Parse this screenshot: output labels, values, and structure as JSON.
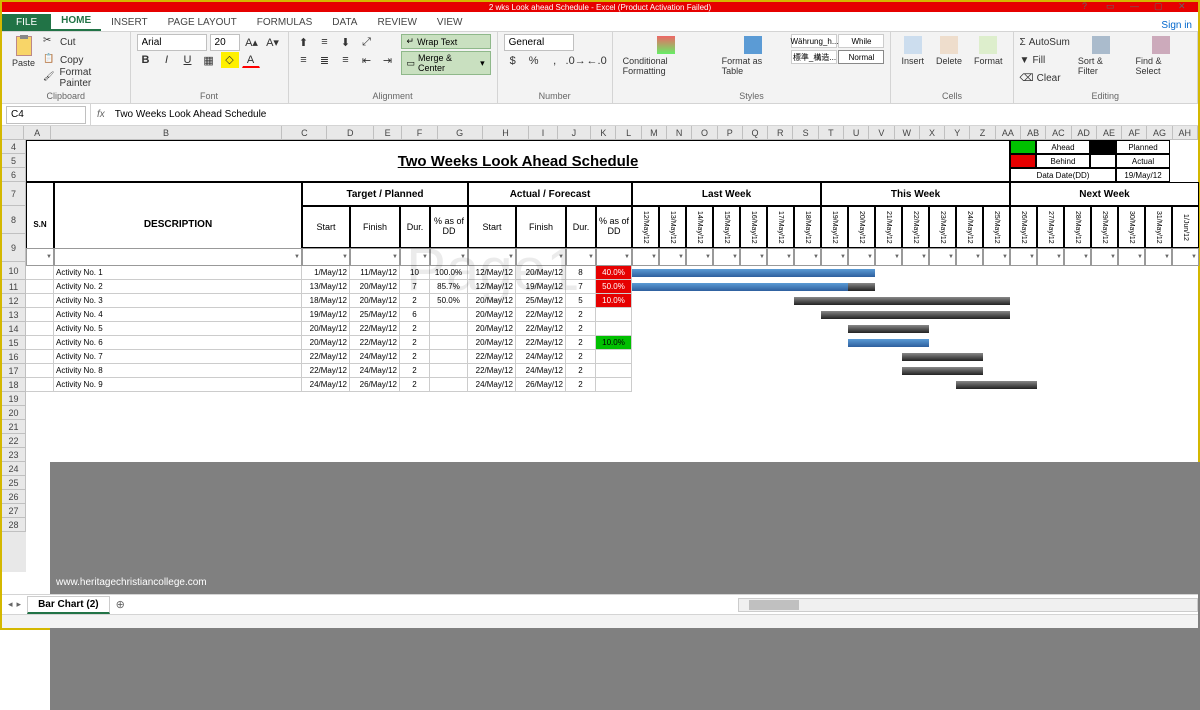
{
  "titlebar": {
    "text": "2 wks Look ahead Schedule - Excel (Product Activation Failed)"
  },
  "tabs": {
    "file": "FILE",
    "items": [
      "HOME",
      "INSERT",
      "PAGE LAYOUT",
      "FORMULAS",
      "DATA",
      "REVIEW",
      "VIEW"
    ],
    "signin": "Sign in"
  },
  "ribbon": {
    "clipboard": {
      "paste": "Paste",
      "cut": "Cut",
      "copy": "Copy",
      "fp": "Format Painter",
      "label": "Clipboard"
    },
    "font": {
      "name": "Arial",
      "size": "20",
      "label": "Font"
    },
    "alignment": {
      "wrap": "Wrap Text",
      "merge": "Merge & Center",
      "label": "Alignment"
    },
    "number": {
      "fmt": "General",
      "label": "Number"
    },
    "styles": {
      "cf": "Conditional Formatting",
      "fat": "Format as Table",
      "s1": "Währung_h...",
      "s2": "標準_構造...",
      "s3": "While",
      "s4": "Normal",
      "label": "Styles"
    },
    "cells": {
      "insert": "Insert",
      "delete": "Delete",
      "format": "Format",
      "label": "Cells"
    },
    "editing": {
      "autosum": "AutoSum",
      "fill": "Fill",
      "clear": "Clear",
      "sort": "Sort & Filter",
      "find": "Find & Select",
      "label": "Editing"
    }
  },
  "fbar": {
    "cell": "C4",
    "formula": "Two Weeks Look Ahead Schedule"
  },
  "cols": [
    "A",
    "B",
    "C",
    "D",
    "E",
    "F",
    "G",
    "H",
    "I",
    "J",
    "K",
    "L",
    "M",
    "N",
    "O",
    "P",
    "Q",
    "R",
    "S",
    "T",
    "U",
    "V",
    "W",
    "X",
    "Y",
    "Z",
    "AA",
    "AB",
    "AC",
    "AD",
    "AE",
    "AF",
    "AG",
    "AH"
  ],
  "rows": [
    "4",
    "5",
    "6",
    "7",
    "8",
    "9",
    "10",
    "11",
    "12",
    "13",
    "14",
    "15",
    "16",
    "17",
    "18",
    "19",
    "20",
    "21",
    "22",
    "23",
    "24",
    "25",
    "26",
    "27",
    "28"
  ],
  "schedule": {
    "title": "Two Weeks Look Ahead Schedule",
    "legend": {
      "ahead": "Ahead",
      "behind": "Behind",
      "planned": "Planned",
      "actual": "Actual",
      "dd_label": "Data Date(DD)",
      "dd_val": "19/May/12"
    },
    "headers": {
      "sn": "S.N",
      "desc": "DESCRIPTION",
      "target": "Target / Planned",
      "actual": "Actual / Forecast",
      "last": "Last Week",
      "this": "This Week",
      "next": "Next Week",
      "start": "Start",
      "finish": "Finish",
      "dur": "Dur.",
      "pct": "% as of DD"
    },
    "days": [
      "12/May/12",
      "13/May/12",
      "14/May/12",
      "15/May/12",
      "16/May/12",
      "17/May/12",
      "18/May/12",
      "19/May/12",
      "20/May/12",
      "21/May/12",
      "22/May/12",
      "23/May/12",
      "24/May/12",
      "25/May/12",
      "26/May/12",
      "27/May/12",
      "28/May/12",
      "29/May/12",
      "30/May/12",
      "31/May/12",
      "1/Jun/12"
    ],
    "activities": [
      {
        "name": "Activity No. 1",
        "ts": "1/May/12",
        "tf": "11/May/12",
        "td": "10",
        "tp": "100.0%",
        "as": "12/May/12",
        "af": "20/May/12",
        "ad": "8",
        "ap": "40.0%",
        "apc": "red"
      },
      {
        "name": "Activity No. 2",
        "ts": "13/May/12",
        "tf": "20/May/12",
        "td": "7",
        "tp": "85.7%",
        "as": "12/May/12",
        "af": "19/May/12",
        "ad": "7",
        "ap": "50.0%",
        "apc": "red"
      },
      {
        "name": "Activity No. 3",
        "ts": "18/May/12",
        "tf": "20/May/12",
        "td": "2",
        "tp": "50.0%",
        "as": "20/May/12",
        "af": "25/May/12",
        "ad": "5",
        "ap": "10.0%",
        "apc": "red"
      },
      {
        "name": "Activity No. 4",
        "ts": "19/May/12",
        "tf": "25/May/12",
        "td": "6",
        "tp": "",
        "as": "20/May/12",
        "af": "22/May/12",
        "ad": "2",
        "ap": "",
        "apc": ""
      },
      {
        "name": "Activity No. 5",
        "ts": "20/May/12",
        "tf": "22/May/12",
        "td": "2",
        "tp": "",
        "as": "20/May/12",
        "af": "22/May/12",
        "ad": "2",
        "ap": "",
        "apc": ""
      },
      {
        "name": "Activity No. 6",
        "ts": "20/May/12",
        "tf": "22/May/12",
        "td": "2",
        "tp": "",
        "as": "20/May/12",
        "af": "22/May/12",
        "ad": "2",
        "ap": "10.0%",
        "apc": "green"
      },
      {
        "name": "Activity No. 7",
        "ts": "22/May/12",
        "tf": "24/May/12",
        "td": "2",
        "tp": "",
        "as": "22/May/12",
        "af": "24/May/12",
        "ad": "2",
        "ap": "",
        "apc": ""
      },
      {
        "name": "Activity No. 8",
        "ts": "22/May/12",
        "tf": "24/May/12",
        "td": "2",
        "tp": "",
        "as": "22/May/12",
        "af": "24/May/12",
        "ad": "2",
        "ap": "",
        "apc": ""
      },
      {
        "name": "Activity No. 9",
        "ts": "24/May/12",
        "tf": "26/May/12",
        "td": "2",
        "tp": "",
        "as": "24/May/12",
        "af": "26/May/12",
        "ad": "2",
        "ap": "",
        "apc": ""
      }
    ]
  },
  "watermark_url": "www.heritagechristiancollege.com",
  "sheettab": "Bar Chart (2)",
  "page_wm": "Page1"
}
